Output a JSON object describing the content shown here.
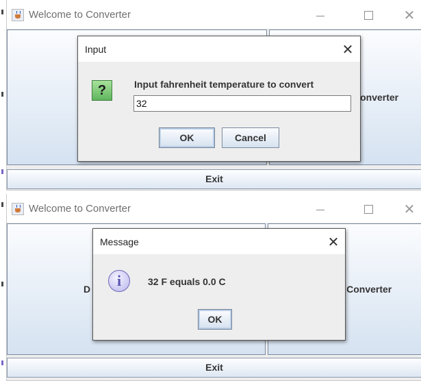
{
  "top_panel": {
    "window": {
      "title": "Welcome to Converter",
      "icon": "java-cup-icon",
      "close_glyph": "✕",
      "buttons": {
        "right_label": "Converter",
        "exit_label": "Exit"
      }
    },
    "dialog": {
      "title": "Input",
      "icon": "question-icon",
      "icon_glyph": "?",
      "close_glyph": "✕",
      "prompt": "Input fahrenheit temperature to convert",
      "input_value": "32",
      "ok_label": "OK",
      "cancel_label": "Cancel"
    }
  },
  "bottom_panel": {
    "window": {
      "title": "Welcome to Converter",
      "icon": "java-cup-icon",
      "close_glyph": "✕",
      "buttons": {
        "left_fragment": "D",
        "right_label": "re Converter",
        "exit_label": "Exit"
      }
    },
    "dialog": {
      "title": "Message",
      "icon": "info-icon",
      "icon_glyph": "i",
      "close_glyph": "✕",
      "message": "32 F equals 0.0 C",
      "ok_label": "OK"
    }
  },
  "colors": {
    "button_gradient_top": "#fbfcfe",
    "button_gradient_bottom": "#d5e2f1",
    "dialog_background": "#eeeeee",
    "question_icon_green": "#5fb55f",
    "info_icon_purple": "#b8b4ec"
  }
}
